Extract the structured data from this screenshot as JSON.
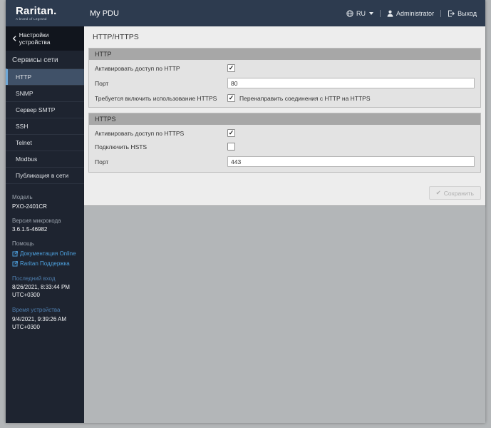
{
  "header": {
    "brand": "Raritan.",
    "brand_tagline": "A brand of Legrand",
    "app_title": "My PDU",
    "language": "RU",
    "user_name": "Administrator",
    "logout_label": "Выход"
  },
  "sidebar": {
    "back_link_label": "Настройки устройства",
    "section_title": "Сервисы сети",
    "items": [
      {
        "label": "HTTP",
        "active": true
      },
      {
        "label": "SNMP",
        "active": false
      },
      {
        "label": "Сервер SMTP",
        "active": false
      },
      {
        "label": "SSH",
        "active": false
      },
      {
        "label": "Telnet",
        "active": false
      },
      {
        "label": "Modbus",
        "active": false
      },
      {
        "label": "Публикация в сети",
        "active": false
      }
    ],
    "info": {
      "model_label": "Модель",
      "model_value": "PXO-2401CR",
      "firmware_label": "Версия микрокода",
      "firmware_value": "3.6.1.5-46982",
      "help_label": "Помощь",
      "help_link_docs": "Документация Online",
      "help_link_support": "Raritan Поддержка",
      "last_login_label": "Последний вход",
      "last_login_value": "8/26/2021, 8:33:44 PM UTC+0300",
      "device_time_label": "Время устройства",
      "device_time_value": "9/4/2021, 9:39:26 AM UTC+0300"
    }
  },
  "main": {
    "page_title": "HTTP/HTTPS",
    "groups": [
      {
        "title": "HTTP",
        "rows": [
          {
            "label": "Активировать доступ по HTTP",
            "type": "checkbox",
            "checked": true,
            "glyph": "✓"
          },
          {
            "label": "Порт",
            "type": "input",
            "value": "80"
          },
          {
            "label": "Требуется включить использование HTTPS",
            "type": "checkbox",
            "checked": true,
            "glyph": "✓",
            "inline_label": "Перенаправить  соединения с HTTP на HTTPS"
          }
        ]
      },
      {
        "title": "HTTPS",
        "rows": [
          {
            "label": "Активировать доступ по HTTPS",
            "type": "checkbox",
            "checked": true,
            "glyph": "✓"
          },
          {
            "label": "Подключить HSTS",
            "type": "checkbox",
            "checked": false,
            "glyph": ""
          },
          {
            "label": "Порт",
            "type": "input",
            "value": "443"
          }
        ]
      }
    ],
    "save_button": {
      "icon_glyph": "✔",
      "label": "Сохранить",
      "disabled": true
    }
  },
  "colors": {
    "topbar_bg": "#2d3b4f",
    "sidebar_bg": "#1e2430",
    "active_item_bg": "#405168",
    "active_item_border": "#6fa8d8",
    "link_blue": "#4da0dd",
    "muted_blue_label": "#4d7cab",
    "panel_bg": "#ededed",
    "group_header_bg": "#a7a7a7",
    "group_body_bg": "#e3e3e3",
    "outer_bg": "#b3b6b8"
  }
}
